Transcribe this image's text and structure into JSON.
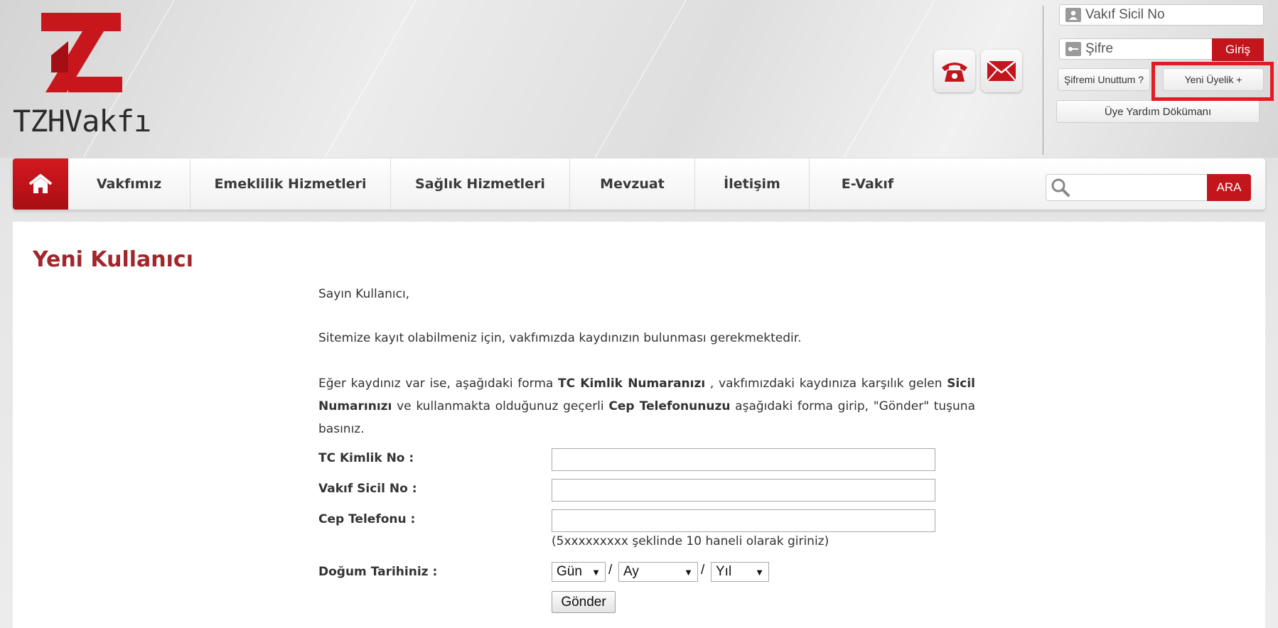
{
  "header": {
    "logo_text": "TZHVakfı",
    "phone_icon": "phone-icon",
    "mail_icon": "mail-icon"
  },
  "login": {
    "sicil_placeholder": "Vakıf Sicil No",
    "password_placeholder": "Şifre",
    "login_button": "Giriş",
    "forgot_password": "Şifremi Unuttum ?",
    "new_membership": "Yeni Üyelik +",
    "help_doc": "Üye Yardım Dökümanı"
  },
  "nav": {
    "home_icon": "home-icon",
    "items": [
      {
        "label": "Vakfımız"
      },
      {
        "label": "Emeklilik Hizmetleri"
      },
      {
        "label": "Sağlık Hizmetleri"
      },
      {
        "label": "Mevzuat"
      },
      {
        "label": "İletişim"
      },
      {
        "label": "E-Vakıf"
      }
    ],
    "search_button": "ARA"
  },
  "page": {
    "title": "Yeni Kullanıcı",
    "greeting": "Sayın Kullanıcı,",
    "intro": "Sitemize kayıt olabilmeniz için, vakfımızda kaydınızın bulunması gerekmektedir.",
    "instruction": {
      "p1": "Eğer kaydınız var ise, aşağıdaki forma ",
      "b1": "TC Kimlik Numaranızı",
      "p2": " , vakfımızdaki kaydınıza karşılık gelen ",
      "b2": "Sicil Numarınızı",
      "p3": " ve kullanmakta olduğunuz geçerli ",
      "b3": "Cep Telefonunuzu",
      "p4": " aşağıdaki forma girip, \"Gönder\" tuşuna basınız."
    }
  },
  "form": {
    "tc_label": "TC Kimlik No :",
    "sicil_label": "Vakıf Sicil No :",
    "phone_label": "Cep Telefonu :",
    "phone_hint": "(5xxxxxxxxx şeklinde 10 haneli olarak giriniz)",
    "birthdate_label": "Doğum Tarihiniz :",
    "day_select": "Gün",
    "month_select": "Ay",
    "year_select": "Yıl",
    "separator": "/",
    "submit": "Gönder"
  },
  "colors": {
    "brand_red": "#c2161c",
    "title_red": "#a0272c",
    "highlight": "#e31b23"
  }
}
